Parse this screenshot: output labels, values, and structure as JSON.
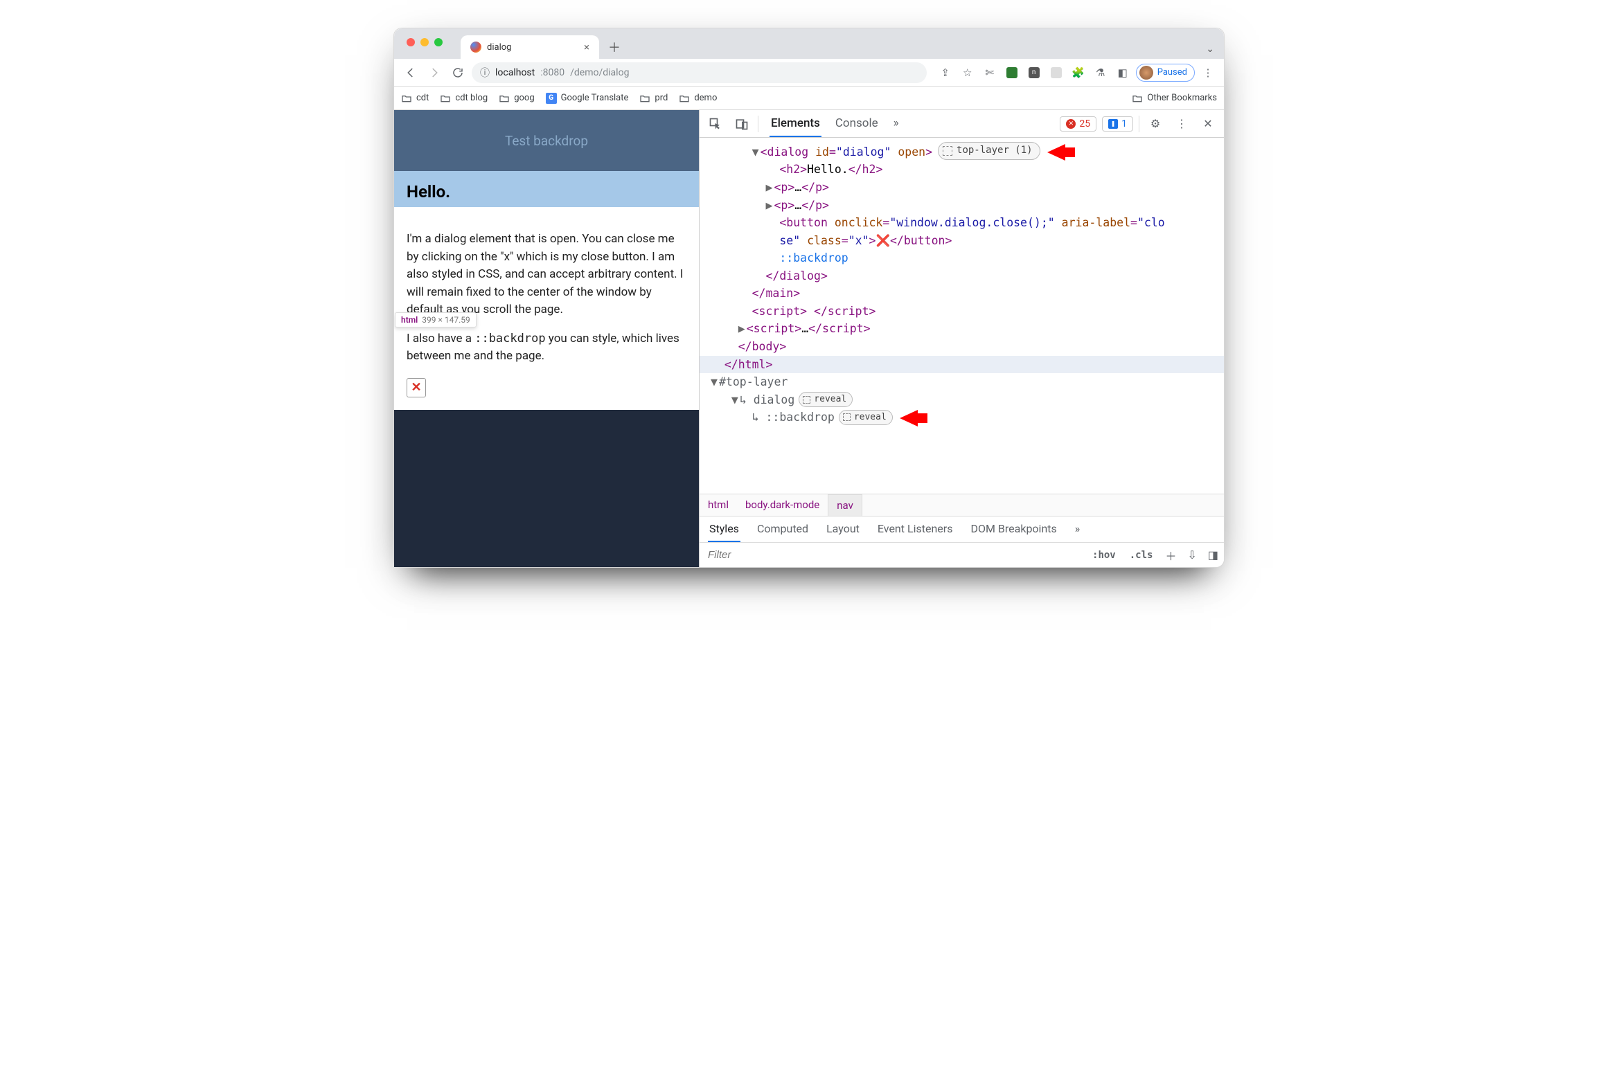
{
  "tab": {
    "title": "dialog"
  },
  "url": {
    "scheme_host": "localhost",
    "port": ":8080",
    "path": "/demo/dialog"
  },
  "profile": {
    "state": "Paused"
  },
  "bookmarks": {
    "items": [
      "cdt",
      "cdt blog",
      "goog",
      "Google Translate",
      "prd",
      "demo"
    ],
    "other": "Other Bookmarks"
  },
  "page": {
    "header": "Test backdrop",
    "dialog_title": "Hello.",
    "p1": "I'm a dialog element that is open. You can close me by clicking on the \"x\" which is my close button. I am also styled in CSS, and can accept arbitrary content. I will remain fixed to the center of the window by default as you scroll the page.",
    "p2a": "I also have a ",
    "p2code": "::backdrop",
    "p2b": " you can style, which lives between me and the page.",
    "tooltip_tag": "html",
    "tooltip_dim": "399 × 147.59"
  },
  "devtools": {
    "tabs": {
      "elements": "Elements",
      "console": "Console"
    },
    "errors": "25",
    "issues": "1",
    "dom": {
      "dialog_open": "<dialog id=\"dialog\" open>",
      "toplayer_badge": "top-layer (1)",
      "h2_open": "<h2>",
      "h2_text": "Hello.",
      "h2_close": "</h2>",
      "p_open": "<p>",
      "ellipsis": "…",
      "p_close": "</p>",
      "button_a": "<button ",
      "onclick_n": "onclick",
      "onclick_v": "\"window.dialog.close();\"",
      "aria_n": "aria-label",
      "aria_v": "\"clo",
      "aria_v2": "se\"",
      "class_n": "class",
      "class_v": "\"x\"",
      "button_end": ">",
      "redx": "❌",
      "button_close": "</button>",
      "backdrop": "::backdrop",
      "dialog_close": "</dialog>",
      "main_close": "</main>",
      "script_inline": "<script>",
      "script_inline_sp": " ",
      "script_inline_close": "</script>",
      "script_ell": "<script>",
      "script_ell_close": "</script>",
      "body_close": "</body>",
      "html_close": "</html>",
      "toplayer_root": "#top-layer",
      "tl_dialog": "dialog",
      "tl_backdrop": "::backdrop",
      "reveal": "reveal"
    },
    "crumbs": {
      "html": "html",
      "body": "body.dark-mode",
      "nav": "nav"
    },
    "subtabs": {
      "styles": "Styles",
      "computed": "Computed",
      "layout": "Layout",
      "el": "Event Listeners",
      "dom": "DOM Breakpoints"
    },
    "filter_placeholder": "Filter",
    "hov": ":hov",
    "cls": ".cls"
  }
}
